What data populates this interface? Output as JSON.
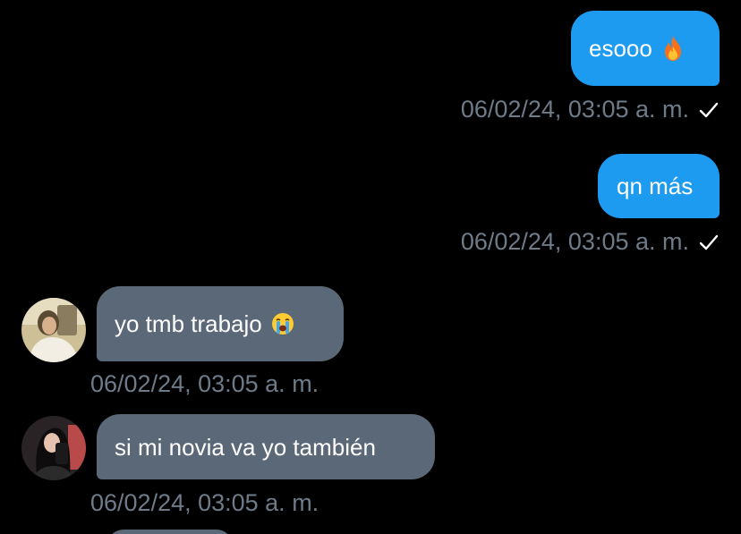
{
  "messages": [
    {
      "direction": "out",
      "text": "esooo",
      "emoji": "fire-emoji",
      "time": "06/02/24, 03:05 a. m.",
      "status": "sent-check-icon"
    },
    {
      "direction": "out",
      "text": "qn más",
      "time": "06/02/24, 03:05 a. m.",
      "status": "sent-check-icon"
    },
    {
      "direction": "in",
      "text": "yo tmb trabajo",
      "emoji": "loudly-crying-face-emoji",
      "time": "06/02/24, 03:05 a. m.",
      "avatar": "sender-avatar"
    },
    {
      "direction": "in",
      "text": "si mi novia va yo también",
      "time": "06/02/24, 03:05 a. m.",
      "avatar": "sender-avatar"
    }
  ],
  "colors": {
    "background": "#000000",
    "outgoing_bubble": "#1d9bf0",
    "incoming_bubble": "#5b6877",
    "timestamp": "#6e7b89",
    "text": "#ffffff"
  }
}
